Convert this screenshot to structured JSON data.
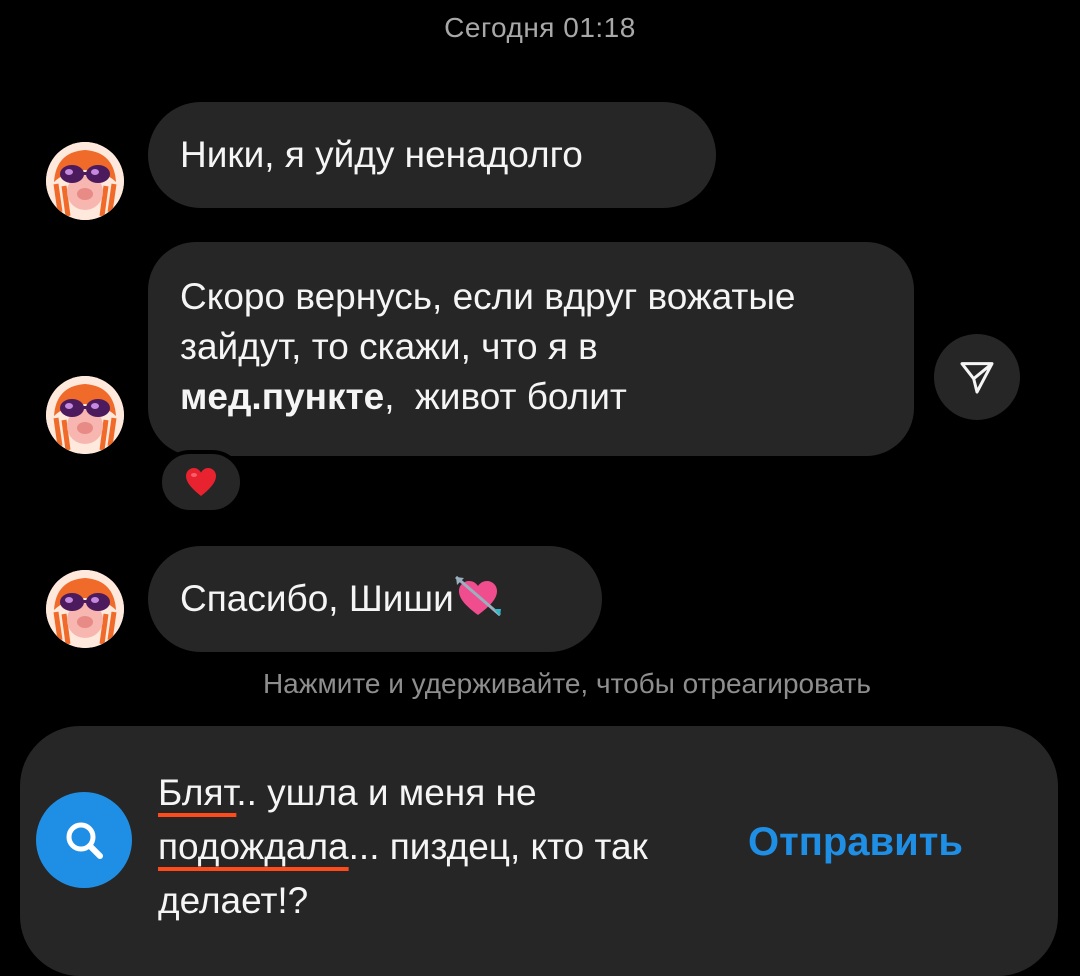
{
  "header": {
    "timestamp": "Сегодня 01:18"
  },
  "messages": [
    {
      "text": "Ники, я уйду ненадолго"
    },
    {
      "text_part1": "Скоро вернусь, если вдруг вожатые зайдут, то скажи, что я в ",
      "text_bold": "мед.пункте",
      "text_part2": ",  живот болит",
      "reaction": "❤️"
    },
    {
      "text": "Спасибо, Шиши",
      "emoji": "heart-with-arrow-icon"
    }
  ],
  "hint": "Нажмите и удерживайте, чтобы отреагировать",
  "composer": {
    "word1": "Блят",
    "text1": ".. ушла и меня не ",
    "word2": "подождала",
    "text2": "... пиздец, кто так делает!?",
    "send_label": "Отправить"
  },
  "colors": {
    "background": "#000000",
    "bubble": "#262626",
    "accent": "#1f8fe6",
    "spellcheck": "#ff4a1c"
  }
}
